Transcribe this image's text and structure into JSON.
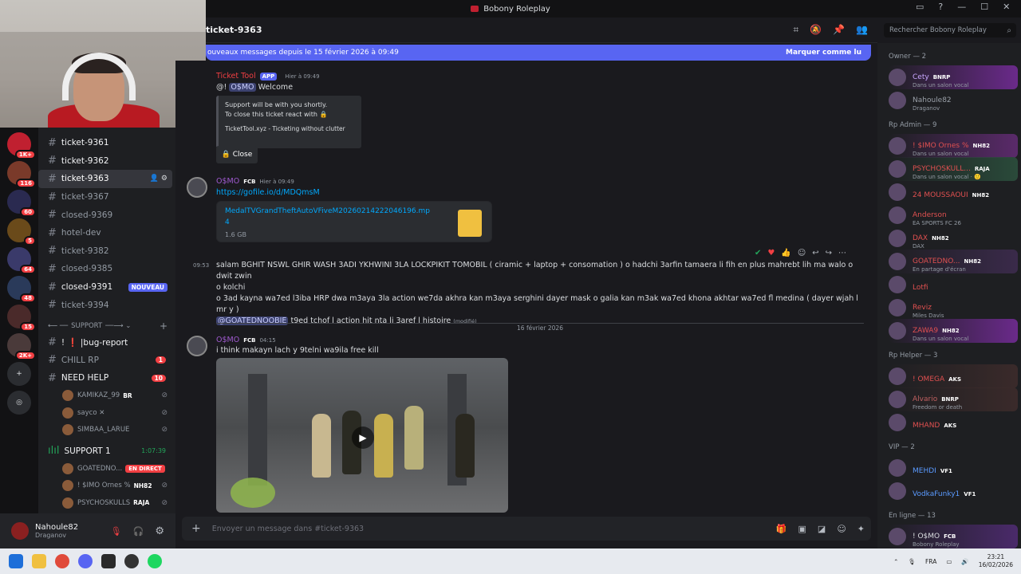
{
  "window": {
    "title": "Bobony Roleplay"
  },
  "header": {
    "channel": "ticket-9363"
  },
  "search": {
    "placeholder": "Rechercher Bobony Roleplay"
  },
  "newbar": {
    "text": "ouveaux messages depuis le 15 février 2026 à 09:49",
    "mark": "Marquer comme lu"
  },
  "guilds": [
    {
      "badge": "1K+"
    },
    {
      "badge": "116"
    },
    {
      "badge": "60"
    },
    {
      "badge": "5"
    },
    {
      "badge": "64"
    },
    {
      "badge": "48"
    },
    {
      "badge": "15"
    },
    {
      "badge": "2K+"
    }
  ],
  "channels": [
    {
      "name": "ticket-9361",
      "bold": true
    },
    {
      "name": "ticket-9362",
      "bold": true
    },
    {
      "name": "ticket-9363",
      "active": true
    },
    {
      "name": "ticket-9367"
    },
    {
      "name": "closed-9369"
    },
    {
      "name": "hotel-dev"
    },
    {
      "name": "ticket-9382"
    },
    {
      "name": "closed-9385"
    },
    {
      "name": "closed-9391",
      "bold": true,
      "badge": "NOUVEAU"
    },
    {
      "name": "ticket-9394"
    }
  ],
  "support_category": "SUPPORT",
  "support_channels": [
    {
      "name": "! ❗ |bug-report",
      "bold": true
    },
    {
      "name": "CHILL RP",
      "badge": "1"
    },
    {
      "name": "NEED HELP",
      "badge": "10",
      "bold": true
    }
  ],
  "voice1": [
    {
      "name": "KAMIKAZ_99",
      "tag": "BR"
    },
    {
      "name": "sayco ✕",
      "tag": ""
    },
    {
      "name": "SIMBAA_LARUE",
      "tag": ""
    }
  ],
  "support_voice": {
    "name": "SUPPORT 1",
    "timer": "1:07:39"
  },
  "voice2": [
    {
      "name": "GOATEDNO...",
      "tag": "EN DIRECT",
      "live": true
    },
    {
      "name": "! $IMO Ornes %",
      "tag": "NH82"
    },
    {
      "name": "PSYCHOSKULLS",
      "tag": "RAJA"
    }
  ],
  "user": {
    "name": "Nahoule82",
    "status": "Draganov"
  },
  "messages": {
    "m1": {
      "author": "Ticket Tool",
      "badge": "APP",
      "time": "Hier à 09:49",
      "text_prefix": "@!",
      "mention": "O$MO",
      "text_suffix": "Welcome",
      "embed_line1": "Support will be with you shortly.",
      "embed_line2": "To close this ticket react with 🔒",
      "embed_footer": "TicketTool.xyz - Ticketing without clutter",
      "button": "🔒 Close"
    },
    "m2": {
      "author": "O$MO",
      "tag": "FCB",
      "time": "Hier à 09:49",
      "link": "https://gofile.io/d/MDQmsM",
      "file_name": "MedalTVGrandTheftAutoVFiveM20260214222046196.mp4",
      "file_size": "1.6 GB"
    },
    "m3": {
      "time": "09:53",
      "line1": "salam BGHIT NSWL GHIR WASH 3ADI YKHWINI 3LA LOCKPIKIT TOMOBIL ( ciramic + laptop + consomation ) o hadchi 3arfin tamaera li fih en plus mahrebt lih ma walo o dwit zwin",
      "line2": "o kolchi",
      "line3": "o 3ad kayna wa7ed l3iba HRP dwa m3aya 3la action we7da akhra kan m3aya serghini dayer mask o galia kan m3ak wa7ed khona akhtar wa7ed fl medina ( dayer wjah l mr y )",
      "mention": "@GOATEDNOOBIE",
      "line4": "t9ed tchof l action hit nta li 3aref l histoire",
      "edited": "(modifié)"
    },
    "divider": "16 février 2026",
    "m4": {
      "author": "O$MO",
      "tag": "FCB",
      "time": "04:15",
      "text": "i think makayn lach y 9telni wa9ila free kill"
    }
  },
  "composer": {
    "placeholder": "Envoyer un message dans #ticket-9363"
  },
  "members": {
    "owner": {
      "title": "Owner — 2",
      "list": [
        {
          "name": "Cety",
          "tag": "BNRP",
          "act": "Dans un salon vocal",
          "color": "#c9a7ff",
          "bg": "#6a2a8a"
        },
        {
          "name": "Nahoule82",
          "tag": "",
          "act": "Draganov",
          "color": "#9aa0a8",
          "bg": ""
        }
      ]
    },
    "admin": {
      "title": "Rp Admin — 9",
      "list": [
        {
          "name": "! $IMO Ornes %",
          "tag": "NH82",
          "act": "Dans un salon vocal",
          "color": "#e05050",
          "bg": "#5a2a6a"
        },
        {
          "name": "PSYCHOSKULL...",
          "tag": "RAJA",
          "act": "Dans un salon vocal · 🙂",
          "color": "#e05050",
          "bg": "#2a4a3a"
        },
        {
          "name": "24 MOUSSAOUI",
          "tag": "NH82",
          "act": "",
          "color": "#e05050",
          "bg": ""
        },
        {
          "name": "Anderson",
          "tag": "",
          "act": "EA SPORTS FC 26",
          "color": "#e05050",
          "bg": ""
        },
        {
          "name": "DAX",
          "tag": "NH82",
          "act": "DAX",
          "color": "#e05050",
          "bg": ""
        },
        {
          "name": "GOATEDNO...",
          "tag": "NH82",
          "act": "En partage d'écran",
          "color": "#e05050",
          "bg": "#3a2a4a"
        },
        {
          "name": "Lotfi",
          "tag": "",
          "act": "",
          "color": "#e05050",
          "bg": ""
        },
        {
          "name": "Reviz",
          "tag": "",
          "act": "Miles Davis",
          "color": "#e05050",
          "bg": ""
        },
        {
          "name": "ZAWA9",
          "tag": "NH82",
          "act": "Dans un salon vocal",
          "color": "#e05050",
          "bg": "#6a2a8a"
        }
      ]
    },
    "helper": {
      "title": "Rp Helper — 3",
      "list": [
        {
          "name": "! OMEGA",
          "tag": "AKS",
          "act": "",
          "color": "#e05050",
          "bg": "#3a2a2a"
        },
        {
          "name": "Alvario",
          "tag": "BNRP",
          "act": "Freedom or death",
          "color": "#c06060",
          "bg": "#3a2a2a"
        },
        {
          "name": "MHAND",
          "tag": "AKS",
          "act": "",
          "color": "#e05050",
          "bg": ""
        }
      ]
    },
    "vip": {
      "title": "VIP — 2",
      "list": [
        {
          "name": "MEHDI",
          "tag": "VF1",
          "act": "",
          "color": "#5a9aff",
          "bg": ""
        },
        {
          "name": "VodkaFunky1",
          "tag": "VF1",
          "act": "",
          "color": "#5a9aff",
          "bg": ""
        }
      ]
    },
    "online": {
      "title": "En ligne — 13",
      "list": [
        {
          "name": "! O$MO",
          "tag": "FCB",
          "act": "Bobony Roleplay",
          "color": "#dbdee1",
          "bg": "#4a2a6a"
        }
      ]
    }
  },
  "tray": {
    "lang": "FRA",
    "time": "23:21",
    "date": "16/02/2026"
  }
}
